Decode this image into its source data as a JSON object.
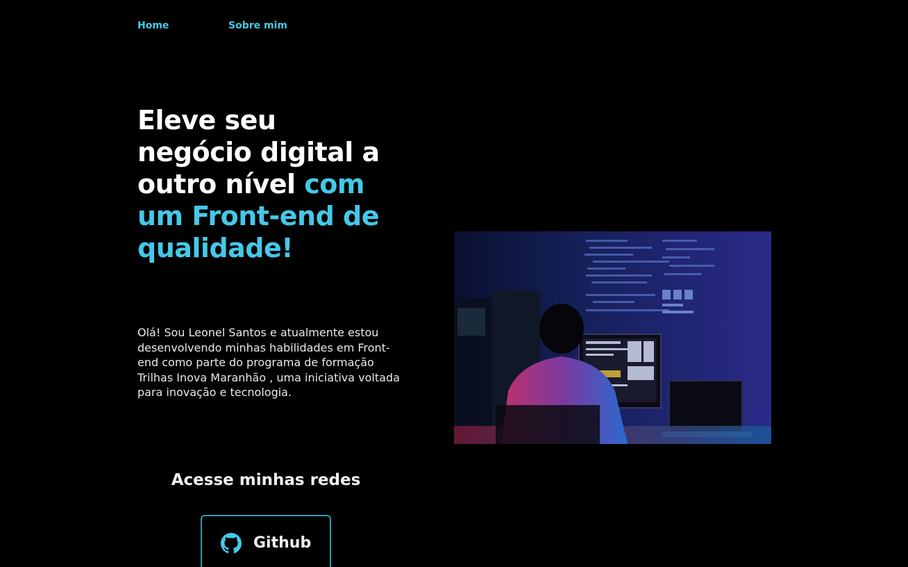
{
  "nav": {
    "items": [
      {
        "label": "Home"
      },
      {
        "label": "Sobre mim"
      }
    ]
  },
  "hero": {
    "title_white": "Eleve seu negócio digital a outro nível",
    "title_accent": "com um Front-end de qualidade!",
    "intro": "Olá! Sou Leonel Santos e atualmente estou desenvolvendo minhas habilidades em Front-end como parte do programa de formação Trilhas Inova Maranhão , uma iniciativa voltada para inovação e tecnologia."
  },
  "social": {
    "heading": "Acesse minhas redes",
    "github_label": "Github",
    "github_icon": "github-icon"
  },
  "colors": {
    "background": "#000000",
    "accent": "#45c8e8",
    "text": "#ffffff",
    "button_border": "#2a9fb5"
  }
}
